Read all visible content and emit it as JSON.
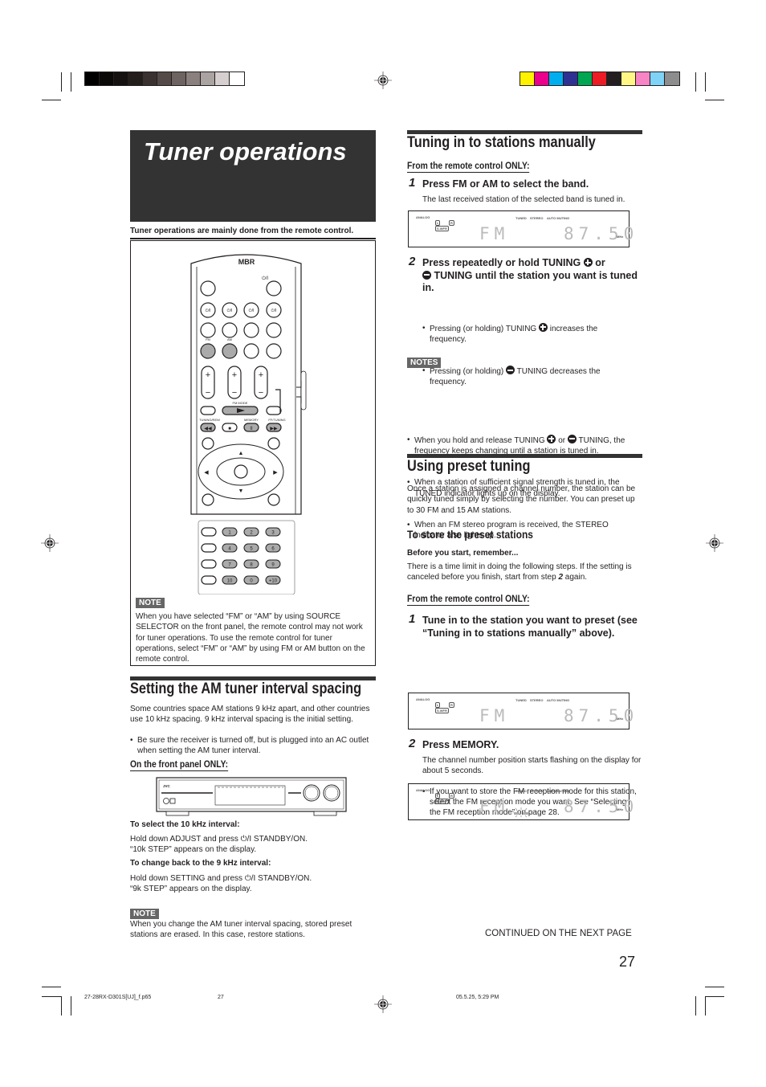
{
  "print_marks": {
    "grayscale_swatches": [
      "#000000",
      "#0b0908",
      "#151110",
      "#231e1c",
      "#3a3230",
      "#544a47",
      "#6d6361",
      "#8a807e",
      "#aba3a1",
      "#d6cfcf",
      "#ffffff"
    ],
    "color_swatches": [
      "#fff200",
      "#ec008c",
      "#00aeef",
      "#2e3192",
      "#00a651",
      "#ed1c24",
      "#231f20",
      "#fff685",
      "#f784c4",
      "#7fd3f7",
      "#8e8d8d"
    ]
  },
  "left": {
    "title": "Tuner operations",
    "lead": "Tuner operations are mainly done from the remote control.",
    "remote": {
      "brand": "MBR",
      "power_label": "⏻/I",
      "fm_label": "FM",
      "am_label": "AM",
      "fm_mode_label": "FM MODE",
      "tuning_rew_label": "TUNING/REW",
      "memory_label": "MEMORY",
      "ff_tuning_label": "FF/TUNING",
      "keypad": [
        "1",
        "2",
        "3",
        "4",
        "5",
        "6",
        "7",
        "8",
        "9",
        "10",
        "0",
        "+10"
      ]
    },
    "note_badge": "NOTE",
    "note_text": "When you have selected “FM” or “AM” by using SOURCE SELECTOR on the front panel, the remote control may not work for tuner operations. To use the remote control for tuner operations, select “FM” or “AM” by using FM or AM button on the remote control.",
    "am_section": {
      "heading": "Setting the AM tuner interval spacing",
      "intro": "Some countries space AM stations 9 kHz apart, and other countries use 10 kHz spacing. 9 kHz interval spacing is the initial setting.",
      "bullet": "Be sure the receiver is turned off, but is plugged into an AC outlet when setting the AM tuner interval.",
      "subheading": "On the front panel ONLY:",
      "device_brand": "JVC",
      "select10_heading": "To select the 10 kHz interval:",
      "select10_line1_pre": "Hold down ADJUST and press",
      "select10_line1_post": "STANDBY/ON.",
      "select10_line2": "“10k STEP” appears on the display.",
      "back9_heading": "To change back to the 9 kHz interval:",
      "back9_line1_pre": "Hold down SETTING and press",
      "back9_line1_post": "STANDBY/ON.",
      "back9_line2": "“9k STEP” appears on the display.",
      "note_badge": "NOTE",
      "note_text": "When you change the AM tuner interval spacing, stored preset stations are erased. In this case, restore stations."
    }
  },
  "right": {
    "manual": {
      "heading": "Tuning in to stations manually",
      "subheading": "From the remote control ONLY:",
      "step1_num": "1",
      "step1_title": "Press FM or AM to select the band.",
      "step1_desc": "The last received station of the selected band is tuned in.",
      "step2_num": "2",
      "step2_title_a": "Press repeatedly or hold TUNING",
      "step2_title_b": "or",
      "step2_title_c": "TUNING until the station you want is tuned in.",
      "step2_b1_pre": "Pressing (or holding) TUNING",
      "step2_b1_post": "increases the frequency.",
      "step2_b2_pre": "Pressing (or holding)",
      "step2_b2_post": "TUNING decreases the frequency.",
      "notes_badge": "NOTES",
      "note1_pre": "When you hold and release TUNING",
      "note1_mid": "or",
      "note1_post": "TUNING, the frequency keeps changing until a station is tuned in.",
      "note2": "When a station of sufficient signal strength is tuned in, the TUNED indicator lights up on the display.",
      "note3": "When an FM stereo program is received, the STEREO indicator also lights up."
    },
    "preset": {
      "heading": "Using preset tuning",
      "intro": "Once a station is assigned a channel number, the station can be quickly tuned simply by selecting the number. You can preset up to 30 FM and 15 AM stations.",
      "store_heading": "To store the preset stations",
      "before_heading": "Before you start, remember...",
      "before_text_pre": "There is a time limit in doing the following steps. If the setting is canceled before you finish, start from step",
      "before_step": "2",
      "before_text_post": "again.",
      "subheading": "From the remote control ONLY:",
      "step1_num": "1",
      "step1_title": "Tune in to the station you want to preset (see “Tuning in to stations manually” above).",
      "step1_bullet": "If you want to store the FM reception mode for this station, select the FM reception mode you want. See “Selecting the FM reception mode” on page 28.",
      "step2_num": "2",
      "step2_title": "Press MEMORY.",
      "step2_desc": "The channel number position starts flashing on the display for about 5 seconds."
    },
    "display": {
      "analog": "ANALOG",
      "l": "L",
      "r": "R",
      "swfr": "S.WFR",
      "tuned": "TUNED",
      "stereo": "STEREO",
      "automuting": "AUTO MUTING",
      "band": "FM",
      "frequency": "87.50",
      "unit": "MHz"
    },
    "continued": "CONTINUED ON THE NEXT PAGE"
  },
  "footer": {
    "page_number": "27",
    "file_name": "27-28RX-D301S[UJ]_f.p65",
    "file_page": "27",
    "timestamp": "05.5.25, 5:29 PM"
  }
}
